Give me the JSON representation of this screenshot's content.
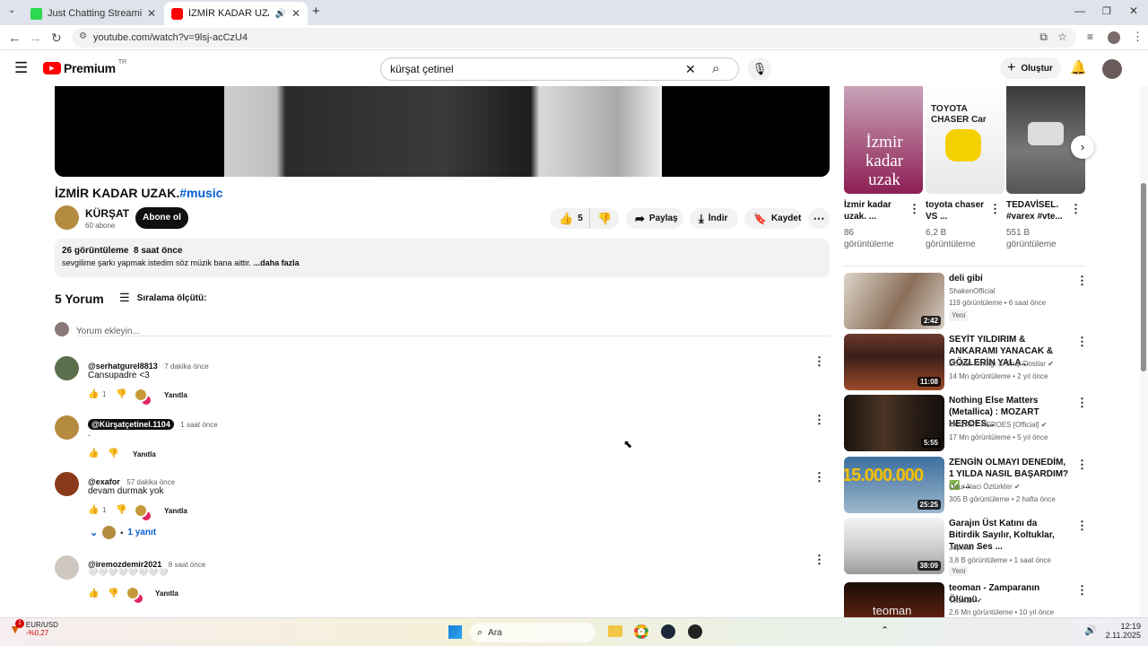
{
  "browser": {
    "tabs": [
      {
        "title": "Just Chatting Streaming - Live S",
        "active": false
      },
      {
        "title": "İZMİR KADAR UZAK.#music",
        "active": true
      }
    ],
    "url": "youtube.com/watch?v=9lsj-acCzU4"
  },
  "header": {
    "logo": "Premium",
    "region": "TR",
    "search_value": "kürşat çetinel",
    "create_label": "Oluştur"
  },
  "video": {
    "title": "İZMİR KADAR UZAK.",
    "hashtag": "#music",
    "channel": "KÜRŞAT",
    "subs": "60 abone",
    "subscribe": "Abone ol",
    "likes": "5",
    "share": "Paylaş",
    "download": "İndir",
    "save": "Kaydet",
    "views_time": "26 görüntüleme  8 saat önce",
    "desc": "sevgilime şarkı yapmak istedim söz müzik bana aittir.",
    "more": "...daha fazla"
  },
  "comments": {
    "count": "5 Yorum",
    "sort": "Sıralama ölçütü:",
    "add_placeholder": "Yorum ekleyin...",
    "reply_label": "Yanıtla",
    "items": [
      {
        "user": "@serhatgurel8813",
        "time": "7 dakika önce",
        "text": "Cansupadre <3",
        "likes": "1"
      },
      {
        "user": "@Kürşatçetinel.1104",
        "time": "1 saat önce",
        "text": ".",
        "likes": ""
      },
      {
        "user": "@exafor",
        "time": "57 dakika önce",
        "text": "devam durmak yok",
        "likes": "1"
      },
      {
        "user": "@iremozdemir2021",
        "time": "8 saat önce",
        "text": "🤍🤍🤍🤍🤍🤍🤍🤍",
        "likes": ""
      }
    ],
    "replies_toggle": "1 yanıt"
  },
  "top_related": [
    {
      "thumb_text": "İzmir kadar uzak",
      "title": "İzmir kadar uzak. ...",
      "meta1": "86",
      "meta2": "görüntüleme"
    },
    {
      "thumb_text": "TOYOTA CHASER Car",
      "title": "toyota chaser VS ...",
      "meta1": "6,2 B",
      "meta2": "görüntüleme"
    },
    {
      "thumb_text": "",
      "title": "TEDAVİSEL. #varex #vte...",
      "meta1": "551 B",
      "meta2": "görüntüleme"
    }
  ],
  "related": [
    {
      "title": "deli gibi",
      "channel": "ShakenOfficial",
      "meta": "119 görüntüleme • 6 saat önce",
      "badge": "Yeni",
      "duration": "2:42",
      "verified": false
    },
    {
      "title": "SEYİT YILDIRIM & ANKARAMI YANACAK & GÖZLERİN YALA...",
      "channel": "Dostlar Konağı & Grup Dostlar",
      "meta": "14 Mn görüntüleme • 2 yıl önce",
      "badge": "",
      "duration": "11:08",
      "verified": true
    },
    {
      "title": "Nothing Else Matters (Metallica) : MOZART HEROES...",
      "channel": "MOZART HEROES [Official]",
      "meta": "17 Mn görüntüleme • 5 yıl önce",
      "badge": "",
      "duration": "5:55",
      "verified": true
    },
    {
      "title": "ZENGİN OLMAYI DENEDİM, 1 YILDA NASIL BAŞARDIM? ✅ ...",
      "channel": "Onur Naci Öztürkler",
      "meta": "305 B görüntüleme • 2 hafta önce",
      "badge": "",
      "duration": "25:25",
      "verified": true,
      "thumb_text": "15.000.000"
    },
    {
      "title": "Garajın Üst Katını da Bitirdik Sayılır, Koltuklar, Tavan Ses ...",
      "channel": "Japonic",
      "meta": "3,8 B görüntüleme • 1 saat önce",
      "badge": "Yeni",
      "duration": "38:09",
      "verified": true
    },
    {
      "title": "teoman - Zamparanın Ölümü",
      "channel": "Teoman",
      "meta": "2,6 Mn görüntüleme • 10 yıl önce",
      "badge": "",
      "duration": "",
      "verified": true,
      "thumb_text": "teoman"
    }
  ],
  "taskbar": {
    "stock_name": "EUR/USD",
    "stock_change": "-%0,27",
    "search_label": "Ara",
    "time": "12:19",
    "date": "2.11.2025",
    "notification_badge": "1"
  },
  "colors": {
    "accent": "#065fd4",
    "red": "#ff0000",
    "tab_bg": "#dfe3eb"
  }
}
